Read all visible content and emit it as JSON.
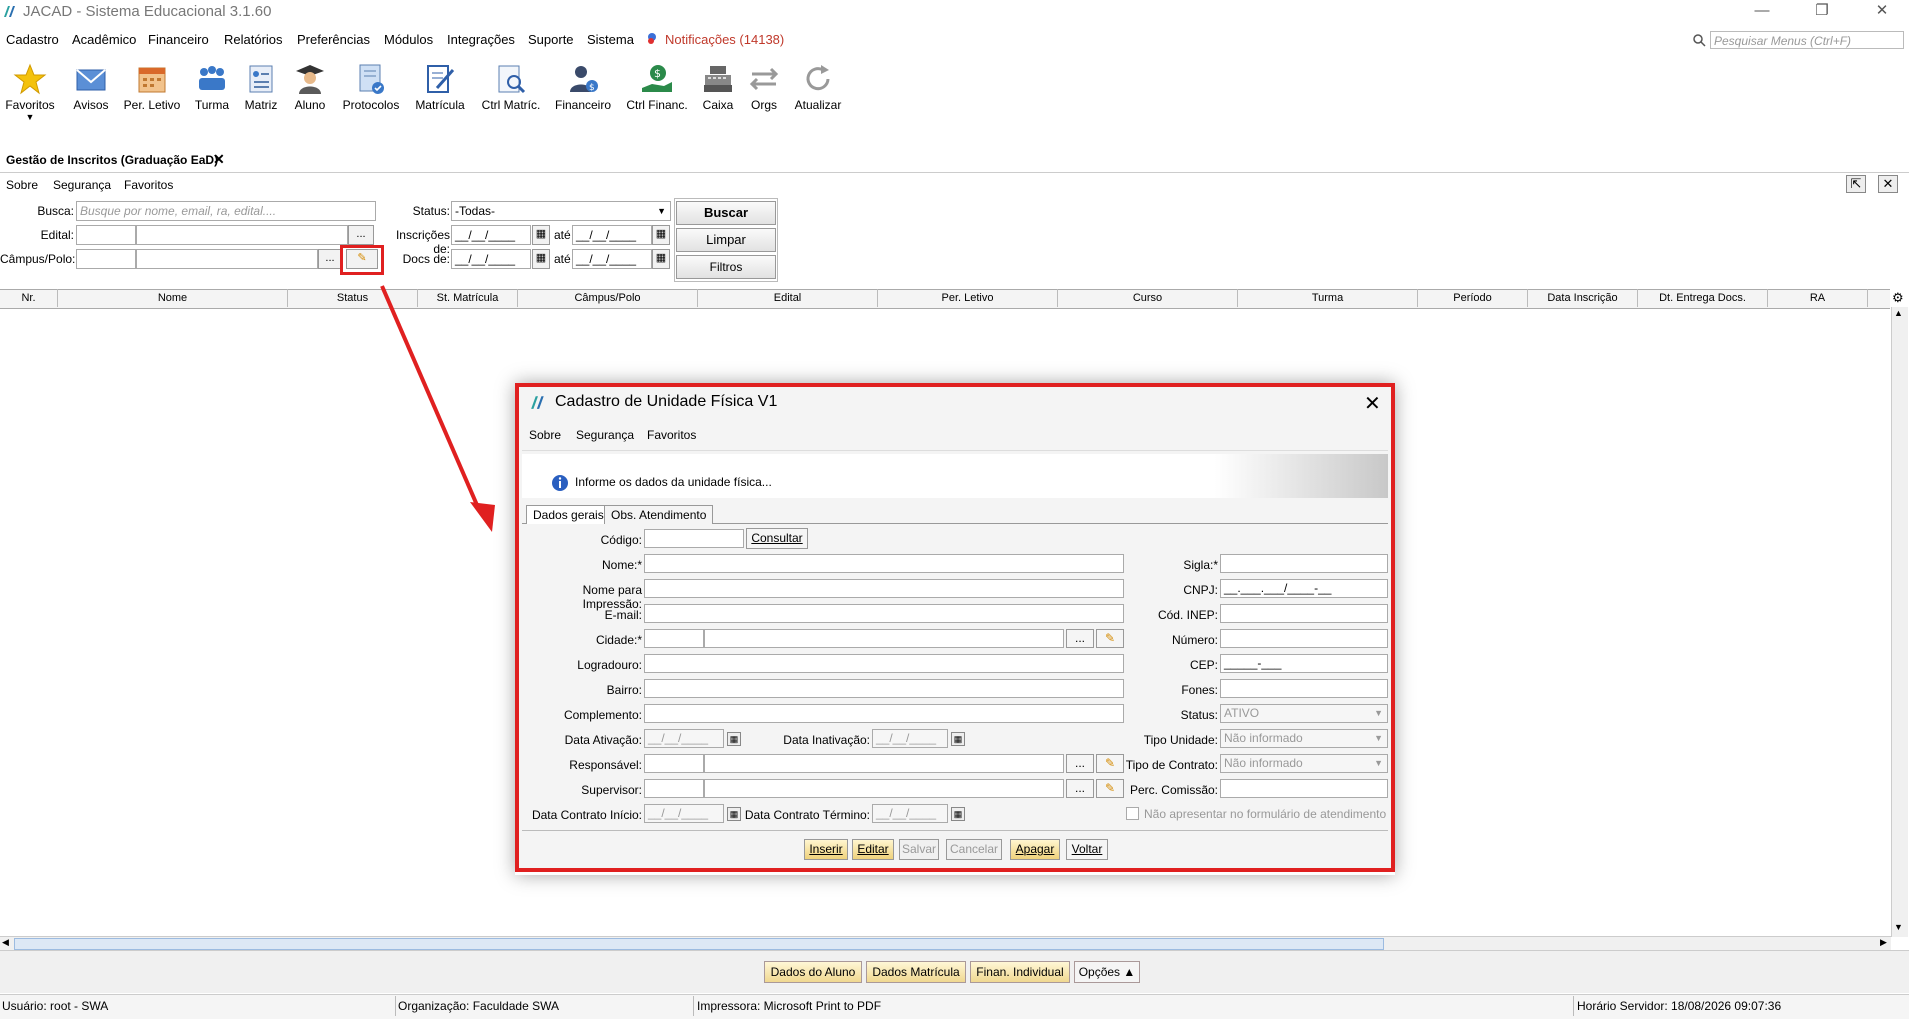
{
  "window": {
    "title": "JACAD - Sistema Educacional 3.1.60",
    "controls": [
      "—",
      "❐",
      "✕"
    ]
  },
  "menubar": {
    "items": [
      "Cadastro",
      "Acadêmico",
      "Financeiro",
      "Relatórios",
      "Preferências",
      "Módulos",
      "Integrações",
      "Suporte",
      "Sistema"
    ],
    "notifications": "Notificações (14138)",
    "search_placeholder": "Pesquisar Menus (Ctrl+F)"
  },
  "toolbar": {
    "items": [
      "Favoritos",
      "Avisos",
      "Per. Letivo",
      "Turma",
      "Matriz",
      "Aluno",
      "Protocolos",
      "Matrícula",
      "Ctrl Matríc.",
      "Financeiro",
      "Ctrl Financ.",
      "Caixa",
      "Orgs",
      "Atualizar"
    ]
  },
  "doc_tab": {
    "label": "Gestão de Inscritos (Graduação EaD)",
    "close": "✕"
  },
  "submenu": [
    "Sobre",
    "Segurança",
    "Favoritos"
  ],
  "filters": {
    "busca_label": "Busca:",
    "busca_placeholder": "Busque por nome, email, ra, edital....",
    "edital_label": "Edital:",
    "campus_label": "Câmpus/Polo:",
    "status_label": "Status:",
    "status_value": "-Todas-",
    "inscricoes_label": "Inscrições de:",
    "docs_label": "Docs de:",
    "ate_label": "até",
    "date_mask": "__/__/____",
    "ellipsis": "...",
    "buttons": [
      "Buscar",
      "Limpar",
      "Filtros"
    ]
  },
  "grid": {
    "columns": [
      "Nr.",
      "Nome",
      "Status",
      "St. Matrícula",
      "Câmpus/Polo",
      "Edital",
      "Per. Letivo",
      "Curso",
      "Turma",
      "Período",
      "Data Inscrição",
      "Dt. Entrega Docs.",
      "RA"
    ]
  },
  "bottom_buttons": [
    "Dados do Aluno",
    "Dados Matrícula",
    "Finan. Individual",
    "Opções ▲"
  ],
  "statusbar": {
    "usuario": "Usuário: root - SWA",
    "organizacao": "Organização: Faculdade SWA",
    "impressora": "Impressora: Microsoft Print to PDF",
    "horario": "Horário Servidor: 18/08/2026 09:07:36"
  },
  "dialog": {
    "title": "Cadastro de Unidade Física V1",
    "menu": [
      "Sobre",
      "Segurança",
      "Favoritos"
    ],
    "info": "Informe os dados da unidade física...",
    "tabs": [
      "Dados gerais",
      "Obs. Atendimento"
    ],
    "labels": {
      "codigo": "Código:",
      "nome": "Nome:*",
      "nome_impressao": "Nome para Impressão:",
      "email": "E-mail:",
      "cidade": "Cidade:*",
      "logradouro": "Logradouro:",
      "bairro": "Bairro:",
      "complemento": "Complemento:",
      "data_ativacao": "Data Ativação:",
      "data_inativacao": "Data Inativação:",
      "responsavel": "Responsável:",
      "supervisor": "Supervisor:",
      "contrato_inicio": "Data Contrato Início:",
      "contrato_termino": "Data Contrato Término:",
      "sigla": "Sigla:*",
      "cnpj": "CNPJ:",
      "cod_inep": "Cód. INEP:",
      "numero": "Número:",
      "cep": "CEP:",
      "fones": "Fones:",
      "status": "Status:",
      "tipo_unidade": "Tipo Unidade:",
      "tipo_contrato": "Tipo de Contrato:",
      "perc_comissao": "Perc. Comissão:"
    },
    "consultar": "Consultar",
    "cnpj_mask": "__.___.___/____-__",
    "cep_mask": "_____-___",
    "date_mask": "__/__/____",
    "status_value": "ATIVO",
    "tipo_unidade_value": "Não informado",
    "tipo_contrato_value": "Não informado",
    "checkbox_label": "Não apresentar no formulário de atendimento",
    "ellipsis": "...",
    "buttons": [
      "Inserir",
      "Editar",
      "Salvar",
      "Cancelar",
      "Apagar",
      "Voltar"
    ],
    "close": "✕"
  }
}
